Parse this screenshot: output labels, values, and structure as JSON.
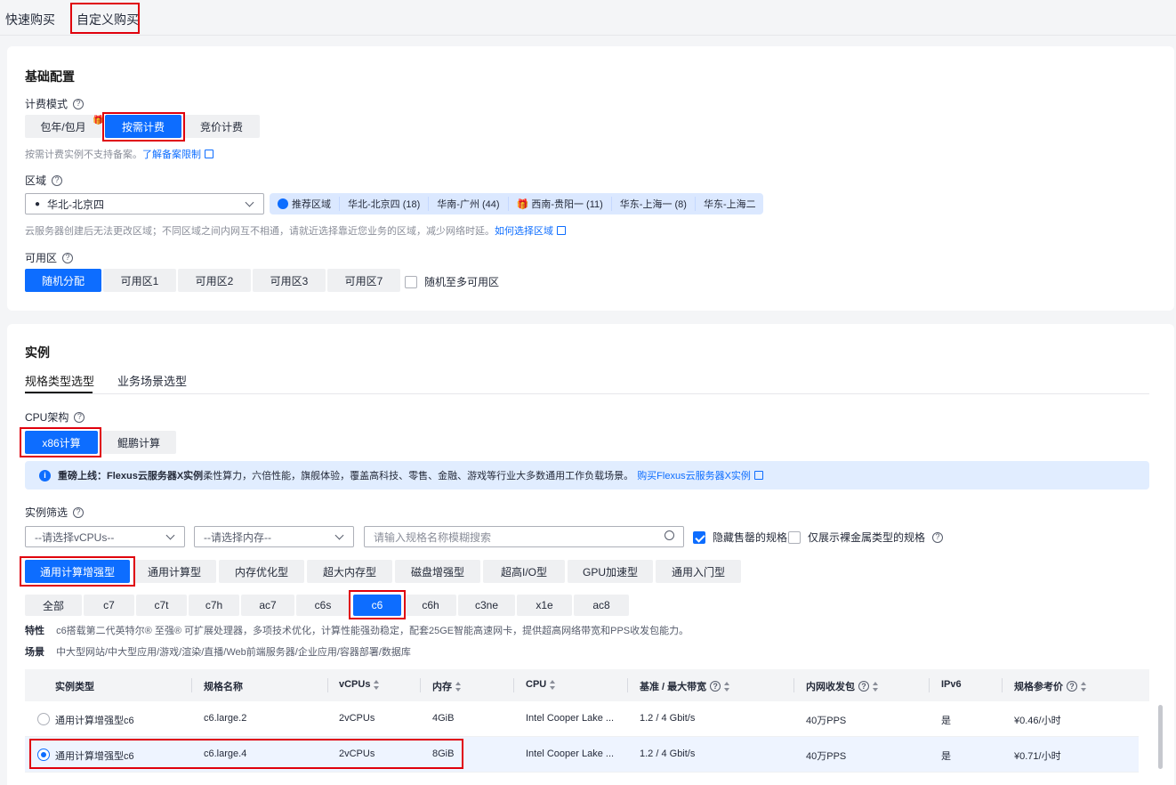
{
  "top_tabs": [
    "快速购买",
    "自定义购买"
  ],
  "basic": {
    "title": "基础配置",
    "billing_label": "计费模式",
    "billing_options": [
      "包年/包月",
      "按需计费",
      "竞价计费"
    ],
    "billing_note": "按需计费实例不支持备案。",
    "billing_link": "了解备案限制",
    "region_label": "区域",
    "region_value": "华北-北京四",
    "recommend_label": "推荐区域",
    "region_chips": [
      "华北-北京四 (18)",
      "华南-广州 (44)",
      "西南-贵阳一 (11)",
      "华东-上海一 (8)",
      "华东-上海二"
    ],
    "region_note": "云服务器创建后无法更改区域；不同区域之间内网互不相通，请就近选择靠近您业务的区域，减少网络时延。",
    "region_link": "如何选择区域",
    "az_label": "可用区",
    "az_options": [
      "随机分配",
      "可用区1",
      "可用区2",
      "可用区3",
      "可用区7"
    ],
    "az_random_multi": "随机至多可用区"
  },
  "instance": {
    "title": "实例",
    "tabs": [
      "规格类型选型",
      "业务场景选型"
    ],
    "cpu_label": "CPU架构",
    "cpu_options": [
      "x86计算",
      "鲲鹏计算"
    ],
    "info_bold": "重磅上线：Flexus云服务器X实例",
    "info_text": " 柔性算力，六倍性能，旗舰体验，覆盖高科技、零售、金融、游戏等行业大多数通用工作负载场景。",
    "info_link": "购买Flexus云服务器X实例",
    "filter_label": "实例筛选",
    "vcpu_placeholder": "--请选择vCPUs--",
    "mem_placeholder": "--请选择内存--",
    "search_placeholder": "请输入规格名称模糊搜索",
    "hide_soldout": "隐藏售罄的规格",
    "only_baremetal": "仅展示裸金属类型的规格",
    "types": [
      "通用计算增强型",
      "通用计算型",
      "内存优化型",
      "超大内存型",
      "磁盘增强型",
      "超高I/O型",
      "GPU加速型",
      "通用入门型"
    ],
    "series": [
      "全部",
      "c7",
      "c7t",
      "c7h",
      "ac7",
      "c6s",
      "c6",
      "c6h",
      "c3ne",
      "x1e",
      "ac8"
    ],
    "feature_label": "特性",
    "feature_text": "c6搭载第二代英特尔® 至强® 可扩展处理器，多项技术优化，计算性能强劲稳定，配套25GE智能高速网卡，提供超高网络带宽和PPS收发包能力。",
    "scene_label": "场景",
    "scene_text": "中大型网站/中大型应用/游戏/渲染/直播/Web前端服务器/企业应用/容器部署/数据库"
  },
  "table": {
    "headers": [
      "实例类型",
      "规格名称",
      "vCPUs",
      "内存",
      "CPU",
      "基准 / 最大带宽",
      "内网收发包",
      "IPv6",
      "规格参考价"
    ],
    "rows": [
      [
        "通用计算增强型c6",
        "c6.large.2",
        "2vCPUs",
        "4GiB",
        "Intel Cooper Lake ...",
        "1.2 / 4 Gbit/s",
        "40万PPS",
        "是",
        "¥0.46/小时"
      ],
      [
        "通用计算增强型c6",
        "c6.large.4",
        "2vCPUs",
        "8GiB",
        "Intel Cooper Lake ...",
        "1.2 / 4 Gbit/s",
        "40万PPS",
        "是",
        "¥0.71/小时"
      ]
    ]
  },
  "colors": {
    "accent": "#0d6dff",
    "highlight": "#e0000c"
  }
}
